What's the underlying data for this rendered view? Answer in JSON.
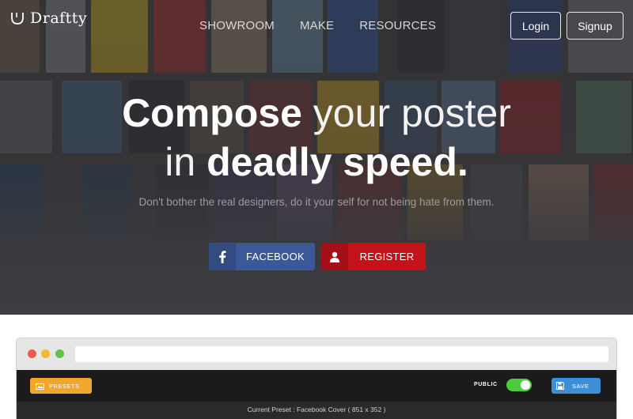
{
  "brand": {
    "name": "Draftty",
    "icon": "shield-cup-icon"
  },
  "nav": {
    "items": [
      "SHOWROOM",
      "MAKE",
      "RESOURCES"
    ]
  },
  "auth": {
    "login_label": "Login",
    "signup_label": "Signup"
  },
  "hero": {
    "line1_bold": "Compose",
    "line1_thin": "your poster",
    "line2_thin": "in",
    "line2_bold": "deadly speed.",
    "subline": "Don't bother the real designers, do it your self for not being hate from them."
  },
  "cta": {
    "facebook_label": "FACEBOOK",
    "facebook_icon": "facebook-icon",
    "register_label": "REGISTER",
    "register_icon": "user-icon"
  },
  "editor": {
    "presets_label": "PRESETS",
    "presets_icon": "image-folder-icon",
    "public_label": "PUBLIC",
    "public_on": true,
    "save_label": "SAVE",
    "save_icon": "floppy-disk-icon",
    "current_preset": "Current Preset : Facebook Cover ( 851 x 352 )"
  },
  "colors": {
    "facebook": "#3b5998",
    "register": "#c4121b",
    "presets": "#f0a72b",
    "save": "#3b8fd9",
    "toggle_on": "#4ccc3c"
  }
}
